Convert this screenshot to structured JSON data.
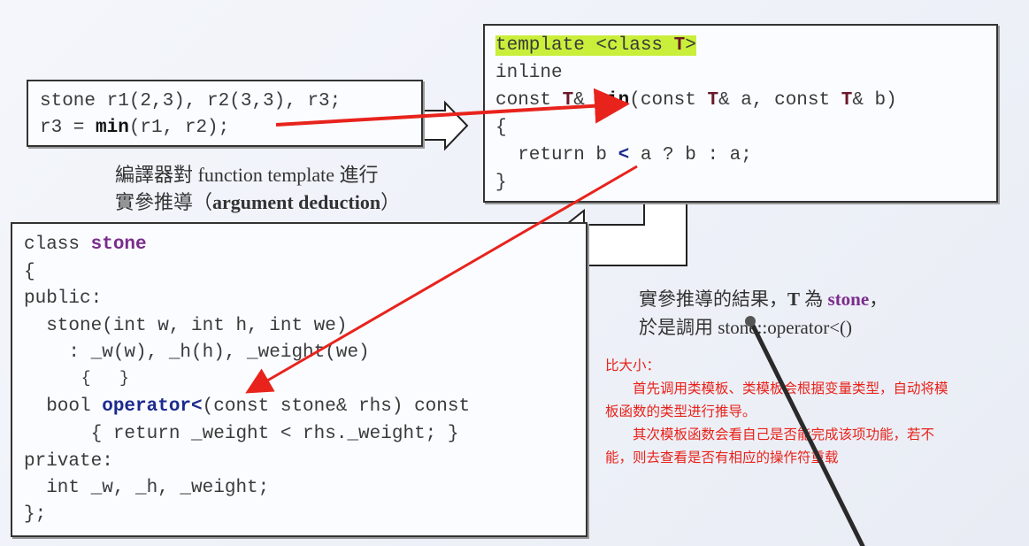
{
  "call_box": {
    "line1": "stone r1(2,3), r2(3,3), r3;",
    "line2_pre": "r3 = ",
    "line2_fn": "min",
    "line2_post": "(r1, r2);"
  },
  "caption_top": {
    "line1": "編譯器對 function template 進行",
    "line2_cjk": "實參推導（",
    "line2_bold": "argument deduction",
    "line2_end": "）"
  },
  "template_box": {
    "l1_a": "template <class ",
    "l1_T": "T",
    "l1_b": ">",
    "l2": "inline",
    "l3_a": "const ",
    "l3_T1": "T",
    "l3_b": "& ",
    "l3_min": "min",
    "l3_c": "(const ",
    "l3_T2": "T",
    "l3_d": "& a, const ",
    "l3_T3": "T",
    "l3_e": "& b)",
    "l4": "{",
    "l5_a": "  return b ",
    "l5_lt": "<",
    "l5_b": " a ? b : a;",
    "l6": "}"
  },
  "class_box": {
    "l1_a": "class ",
    "l1_stone": "stone",
    "l2": "{",
    "l3": "public:",
    "l4": "  stone(int w, int h, int we)",
    "l5": "    : _w(w), _h(h), _weight(we)",
    "l6": "      {   }",
    "l7_a": "  bool ",
    "l7_op": "operator<",
    "l7_b": "(const stone& rhs) const",
    "l8": "      { return _weight < rhs._weight; }",
    "l9": "private:",
    "l10": "  int _w, _h, _weight;",
    "l11": "};"
  },
  "caption_right": {
    "line1_a": "實參推導的結果，",
    "line1_T": "T",
    "line1_b": " 為 ",
    "line1_stone": "stone",
    "line1_c": "，",
    "line2": "於是調用 stone::operator<()"
  },
  "red_note": {
    "title": "比大小：",
    "p1_line1": "　　首先调用类模板、类模板会根据变量类型，自动将模",
    "p1_line2": "板函数的类型进行推导。",
    "p2_line1": "　　其次模板函数会看自己是否能完成该项功能，若不",
    "p2_line2": "能，则去查看是否有相应的操作符重载"
  },
  "colors": {
    "arrow": "#e8231c",
    "highlight": "#c9ef3a",
    "stone_purple": "#7a2c8c",
    "operator_navy": "#1b2a8c"
  }
}
